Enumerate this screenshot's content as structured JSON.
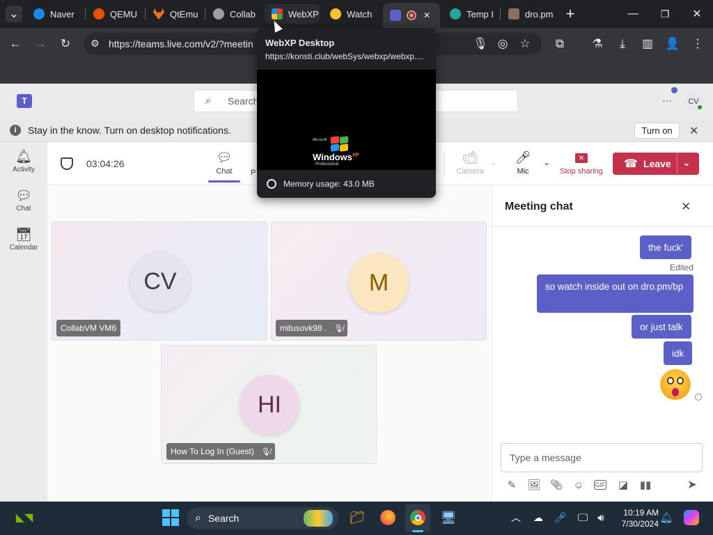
{
  "browser": {
    "tabs": [
      {
        "label": "Naver",
        "color": "#1e88e5"
      },
      {
        "label": "QEMU",
        "color": "#e65100"
      },
      {
        "label": "QtEmu",
        "color": "#fc6d26"
      },
      {
        "label": "Collab",
        "color": "#9e9e9e"
      },
      {
        "label": "WebXP",
        "color": "#43a047"
      },
      {
        "label": "Watch",
        "color": "#fbc02d"
      },
      {
        "label": "",
        "color": "#5b5fc7"
      },
      {
        "label": "Temp I",
        "color": "#26a69a"
      },
      {
        "label": "dro.pm",
        "color": "#8d6e63"
      }
    ],
    "url": "https://teams.live.com/v2/?meetin",
    "tab_close": "✕",
    "new_tab": "+"
  },
  "preview": {
    "title": "WebXP Desktop",
    "url": "https://konsti.club/webSys/webxp/webxp....",
    "memory": "Memory usage: 43.0 MB",
    "logo_top": "Microsoft",
    "logo_main": "Windows",
    "logo_xp": "XP",
    "logo_sub": "Professional"
  },
  "teams": {
    "search_placeholder": "Search",
    "more": "···",
    "user_initials": "CV",
    "notification": "Stay in the know. Turn on desktop notifications.",
    "turn_on": "Turn on"
  },
  "rail": [
    {
      "label": "Activity"
    },
    {
      "label": "Chat"
    },
    {
      "label": "Calendar"
    }
  ],
  "meeting": {
    "timer": "03:04:26",
    "chat_tab": "Chat",
    "people_tab": "P",
    "camera": "Camera",
    "mic": "Mic",
    "stop_sharing": "Stop sharing",
    "leave": "Leave"
  },
  "participants": [
    {
      "initials": "CV",
      "name": "CollabVM VM6"
    },
    {
      "initials": "M",
      "name": "mitusovk98 ."
    },
    {
      "initials": "HI",
      "name": "How To Log In (Guest)"
    }
  ],
  "chat": {
    "title": "Meeting chat",
    "messages": [
      {
        "text": "the fuck'"
      },
      {
        "text": "so watch inside out on dro.pm/bp"
      },
      {
        "text": "or just talk"
      },
      {
        "text": "idk"
      }
    ],
    "edited": "Edited",
    "composer_placeholder": "Type a message"
  },
  "taskbar": {
    "search": "Search",
    "time": "10:19 AM",
    "date": "7/30/2024"
  },
  "colors": {
    "accent": "#5b5fc7",
    "leave": "#c4314b",
    "stop": "#c4314b"
  }
}
